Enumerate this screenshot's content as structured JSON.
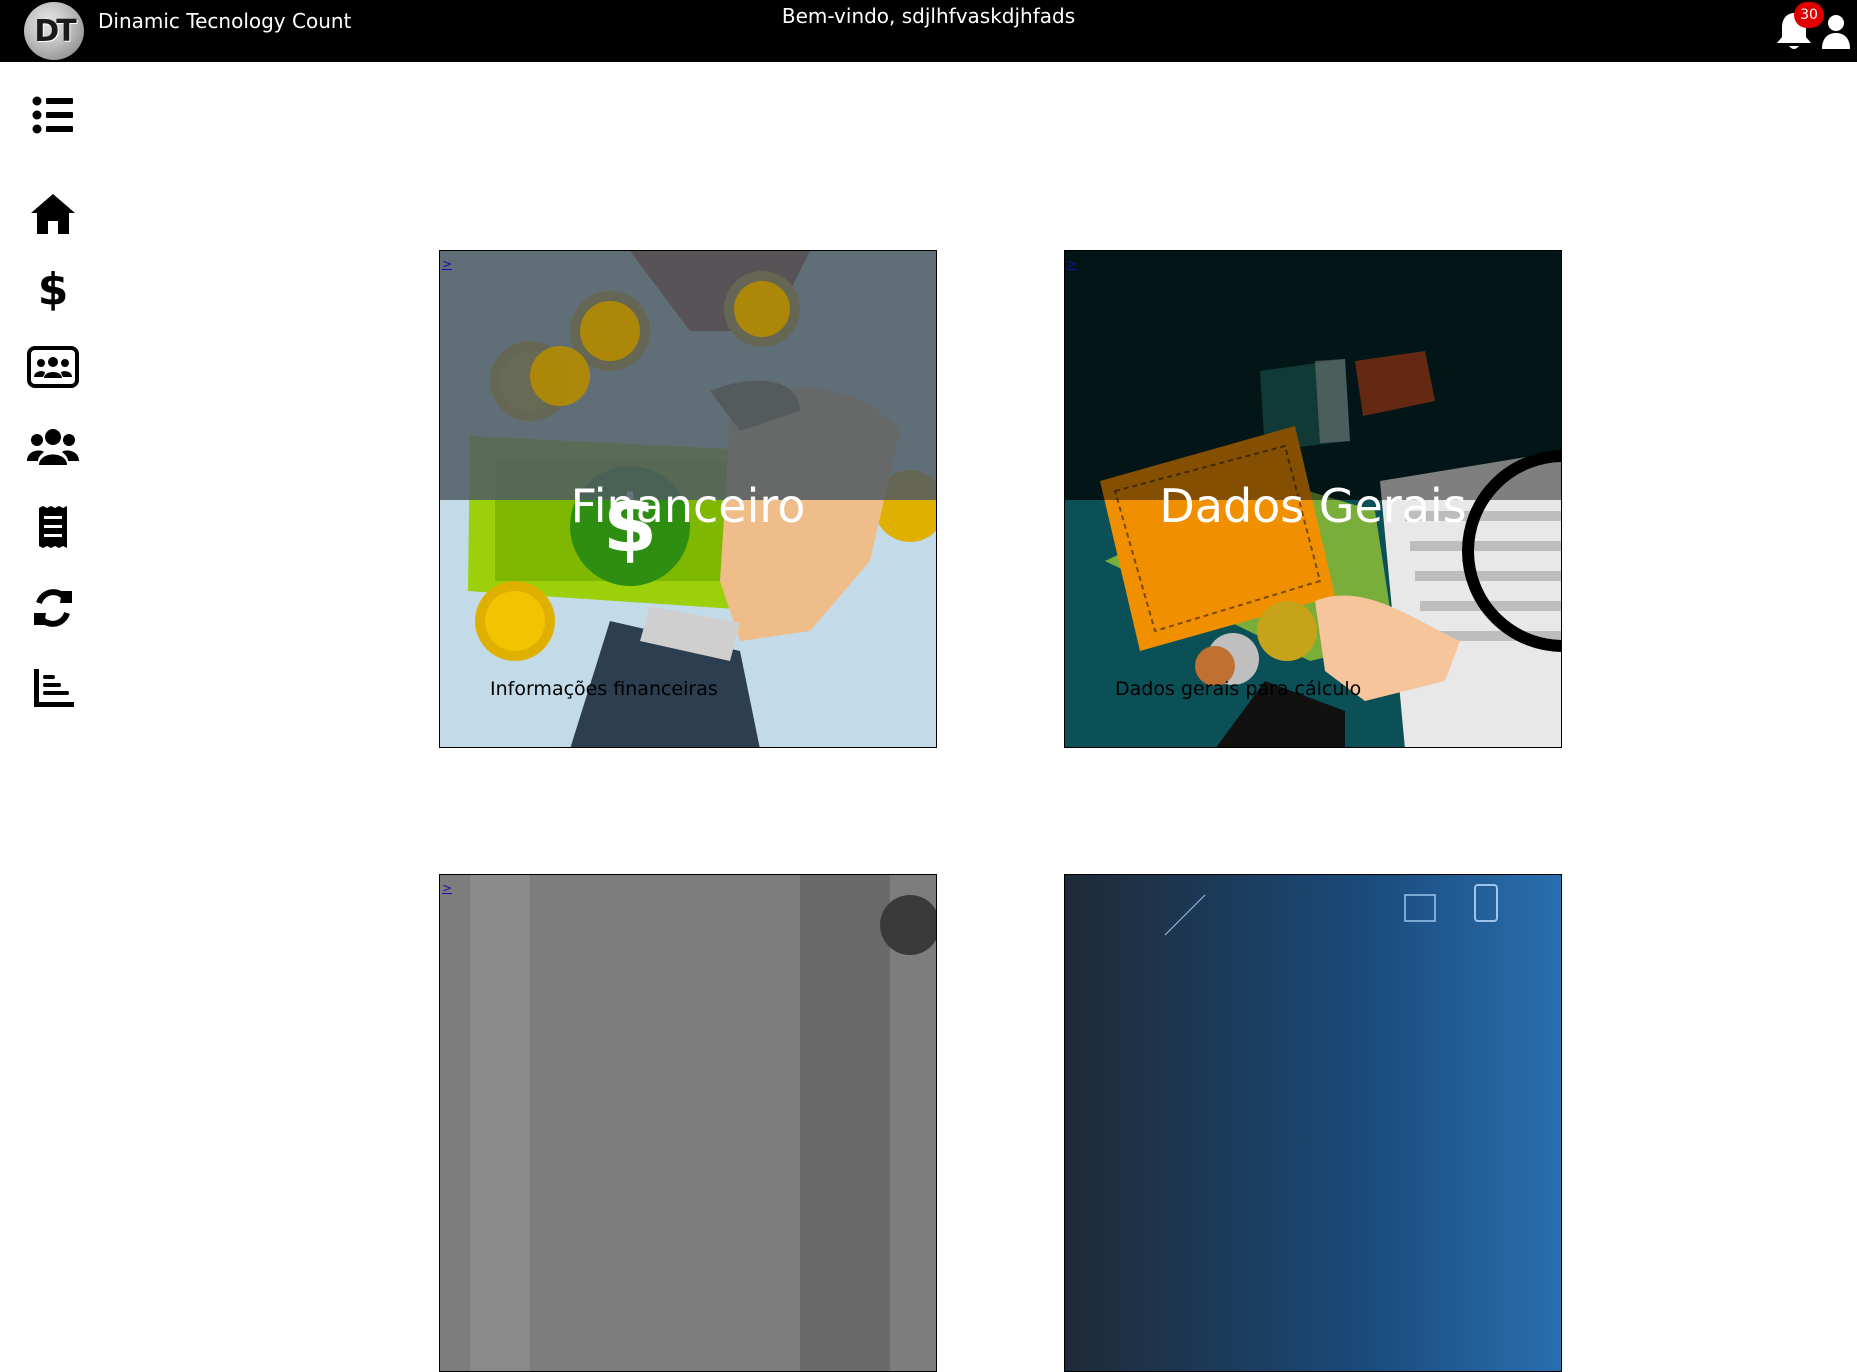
{
  "header": {
    "logo_text": "DT",
    "app_title": "Dinamic Tecnology Count",
    "welcome": "Bem-vindo, sdjlhfvaskdjhfads",
    "notification_count": "30",
    "icons": [
      "bell-icon",
      "user-icon"
    ]
  },
  "sidebar": {
    "items": [
      {
        "icon": "menu-list-icon"
      },
      {
        "icon": "home-icon"
      },
      {
        "icon": "dollar-icon"
      },
      {
        "icon": "team-card-icon"
      },
      {
        "icon": "users-icon"
      },
      {
        "icon": "receipt-icon"
      },
      {
        "icon": "sync-icon"
      },
      {
        "icon": "bar-chart-icon"
      }
    ]
  },
  "cards": [
    {
      "link": ">",
      "title": "Financeiro",
      "description": "Informações financeiras"
    },
    {
      "link": ">",
      "title": "Dados Gerais",
      "description": "Dados gerais para cálculo"
    },
    {
      "link": ">"
    },
    {
      "link": ""
    }
  ],
  "colors": {
    "topbar": "#000000",
    "badge": "#e00000",
    "finance_top": "#5f6b74",
    "finance_bottom": "#c3dae8",
    "dados_top": "#06282b",
    "dados_bottom": "#0b4f57"
  }
}
